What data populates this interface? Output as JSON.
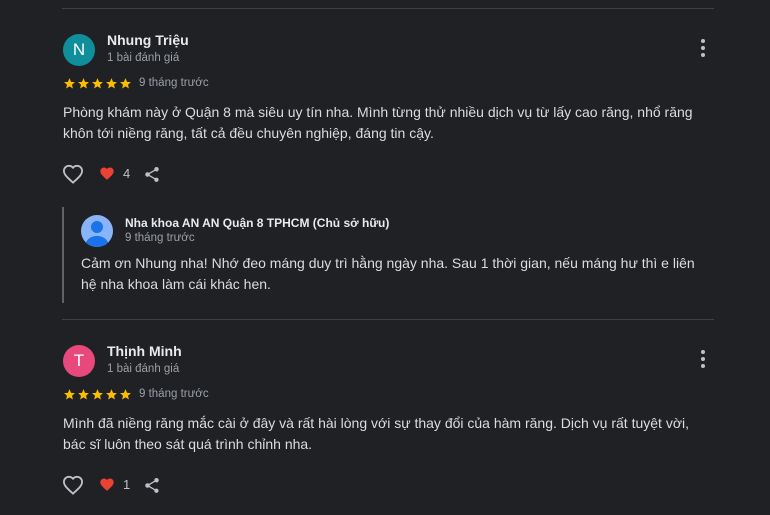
{
  "reviews": [
    {
      "avatar_letter": "N",
      "avatar_color": "#0f8e9c",
      "name": "Nhung Triệu",
      "review_count": "1 bài đánh giá",
      "rating": 5,
      "time": "9 tháng trước",
      "text": "Phòng khám này ở Quận 8 mà siêu uy tín nha. Mình từng thử nhiều dịch vụ từ lấy cao răng, nhổ răng khôn tới niềng răng, tất cả đều chuyên nghiệp, đáng tin cậy.",
      "likes": "4",
      "reply": {
        "owner": "Nha khoa AN AN Quận 8 TPHCM (Chủ sở hữu)",
        "time": "9 tháng trước",
        "text": "Cảm ơn Nhung nha! Nhớ đeo máng duy trì hằng ngày nha. Sau 1 thời gian, nếu máng hư thì e liên hệ nha khoa làm cái khác hen."
      }
    },
    {
      "avatar_letter": "T",
      "avatar_color": "#e8497c",
      "name": "Thịnh Minh",
      "review_count": "1 bài đánh giá",
      "rating": 5,
      "time": "9 tháng trước",
      "text": "Mình đã niềng răng mắc cài ở đây và rất hài lòng với sự thay đổi của hàm răng. Dịch vụ rất tuyệt vời, bác sĩ luôn theo sát quá trình chỉnh nha.",
      "likes": "1"
    }
  ],
  "colors": {
    "star": "#fbbc04",
    "heart": "#ea4335",
    "owner_avatar": "#8ab4f8"
  },
  "icons": [
    "heart-outline-icon",
    "heart-filled-icon",
    "share-icon",
    "more-vert-icon",
    "person-icon",
    "star-icon"
  ]
}
